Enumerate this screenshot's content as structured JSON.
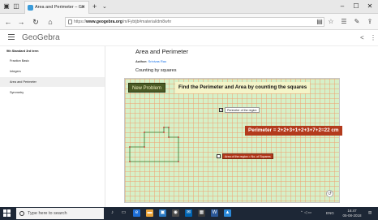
{
  "browser": {
    "tab_title": "Area and Perimeter – Ge",
    "url_prefix": "https://",
    "url_domain": "www.geogebra.org",
    "url_path": "/m/Fybtjb#material/dm8whr"
  },
  "app": {
    "logo": "GeoGebra"
  },
  "sidebar": {
    "heading": "9th Standard 3rd term",
    "items": [
      {
        "label": "Fraction Basic"
      },
      {
        "label": "Integers"
      },
      {
        "label": "Area and Perimeter"
      },
      {
        "label": "Symmetry"
      }
    ]
  },
  "main": {
    "title": "Area and Perimeter",
    "author_prefix": "Author:",
    "author_name": "Srinivas Rao",
    "subtitle": "Counting by squares"
  },
  "applet": {
    "new_problem": "New Problem",
    "heading": "Find the Perimeter and Area by counting the squares",
    "perimeter_checkbox_label": "Perimeter of the region",
    "perimeter_checked": true,
    "perimeter_result": "Perimeter = 2+2+3+1+2+3+7+2=22 cm",
    "area_checkbox_label": "Area of the region = No. of Squares",
    "area_checked": false,
    "colors": {
      "grid_fill": "#d6f0c8",
      "grid_lines": "#f0a070",
      "result_bg": "#b33a1c",
      "heading_bg": "#f4f4c8",
      "shape_stroke": "#2e7d32",
      "vertex": "#c62828"
    }
  },
  "taskbar": {
    "search_placeholder": "Type here to search",
    "lang": "ENG",
    "time": "16:47",
    "date": "05-08-2018"
  }
}
